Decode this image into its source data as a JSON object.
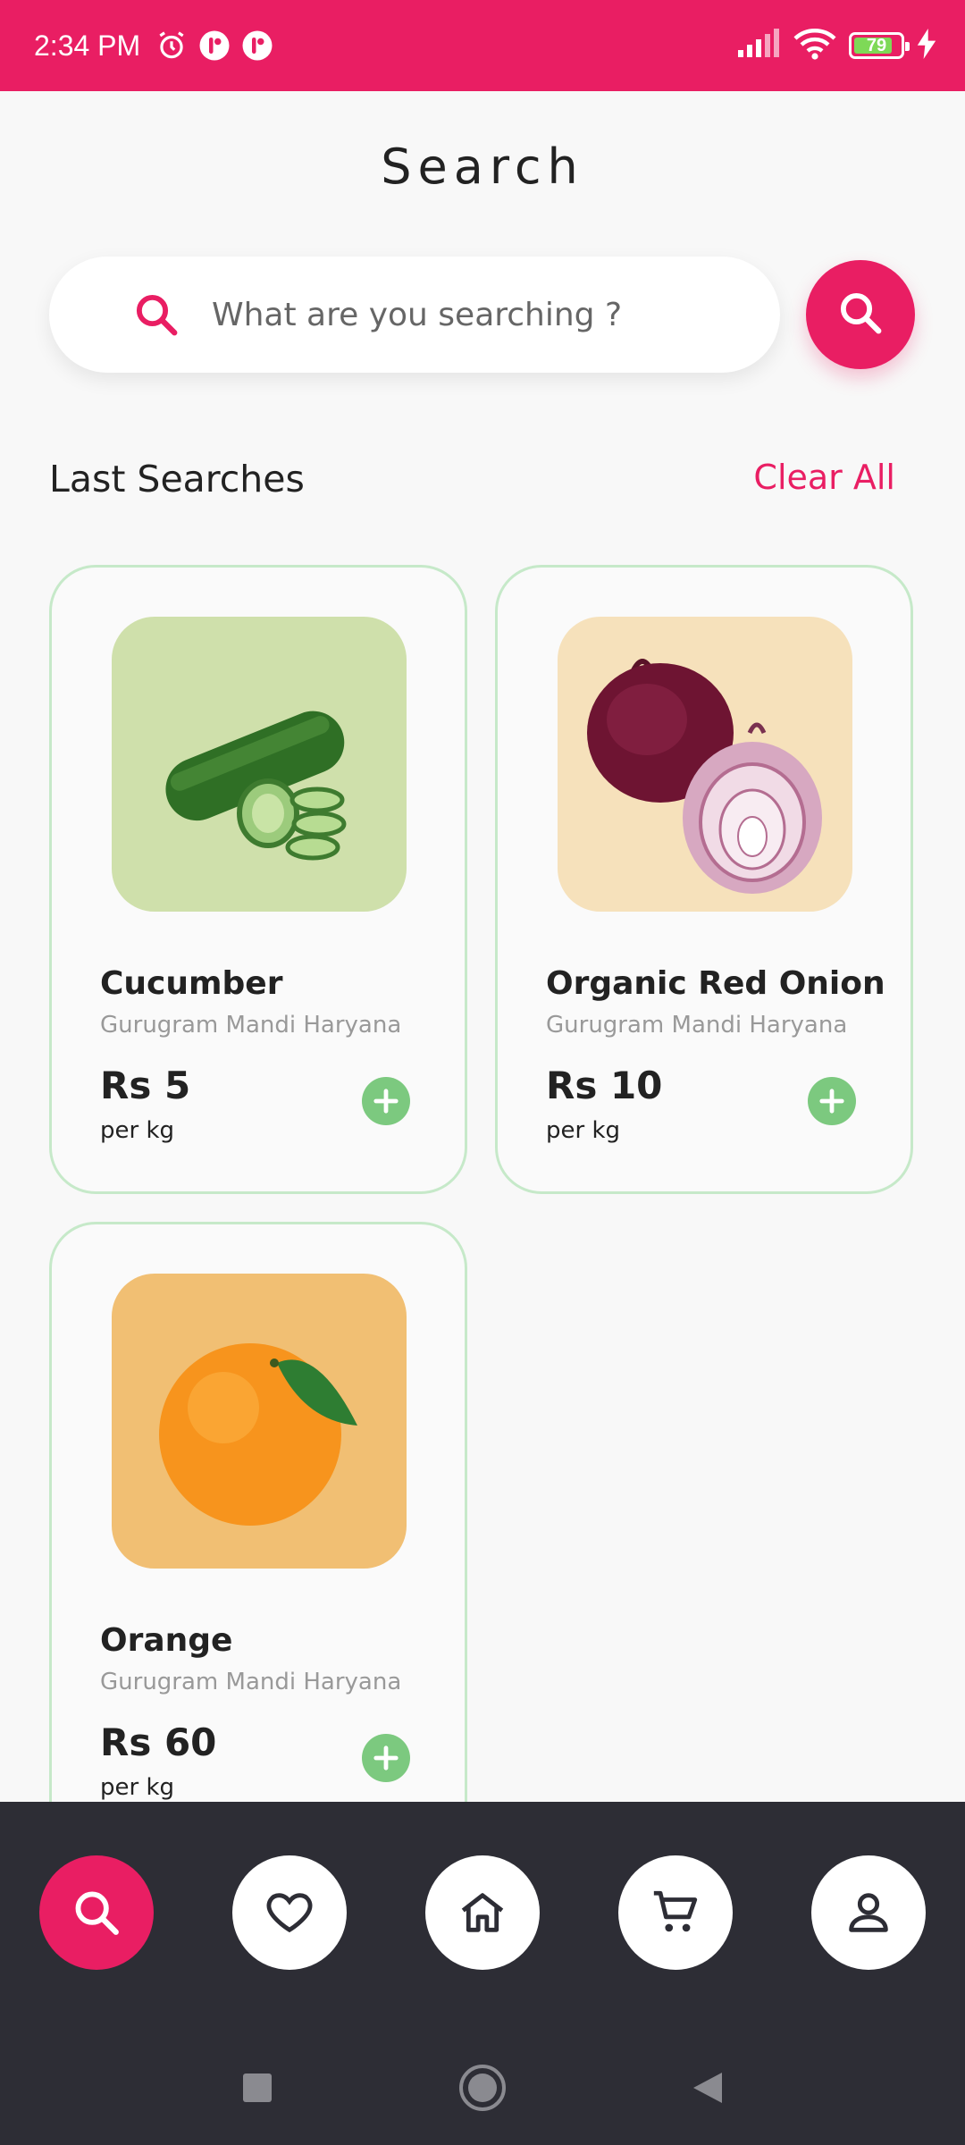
{
  "theme": {
    "accent": "#e91e63",
    "card_border": "#c6e9c9",
    "add_button": "#7cc97f",
    "nav_bg": "#2d2d35"
  },
  "status_bar": {
    "time": "2:34 PM",
    "battery": "79",
    "icons": [
      "alarm-icon",
      "app-notification-icon",
      "app-notification-icon",
      "signal-icon",
      "wifi-icon",
      "battery-icon",
      "charging-icon"
    ]
  },
  "page": {
    "title": "Search"
  },
  "search": {
    "placeholder": "What are you searching ?",
    "value": ""
  },
  "last_searches": {
    "title": "Last Searches",
    "clear_label": "Clear All",
    "items": [
      {
        "name": "Cucumber",
        "location": "Gurugram Mandi Haryana",
        "price": "Rs 5",
        "unit": "per kg",
        "thumb_color": "#cfe0ab",
        "icon": "cucumber-image"
      },
      {
        "name": "Organic Red Onion",
        "location": "Gurugram Mandi Haryana",
        "price": "Rs 10",
        "unit": "per kg",
        "thumb_color": "#f6e1bb",
        "icon": "red-onion-image"
      },
      {
        "name": "Orange",
        "location": "Gurugram Mandi Haryana",
        "price": "Rs 60",
        "unit": "per kg",
        "thumb_color": "#f1bf73",
        "icon": "orange-image"
      }
    ]
  },
  "bottom_nav": {
    "items": [
      {
        "icon": "search-icon",
        "active": true
      },
      {
        "icon": "heart-icon",
        "active": false
      },
      {
        "icon": "home-icon",
        "active": false
      },
      {
        "icon": "cart-icon",
        "active": false
      },
      {
        "icon": "profile-icon",
        "active": false
      }
    ]
  },
  "system_nav": {
    "items": [
      "recents-icon",
      "home-circle-icon",
      "back-icon"
    ]
  }
}
